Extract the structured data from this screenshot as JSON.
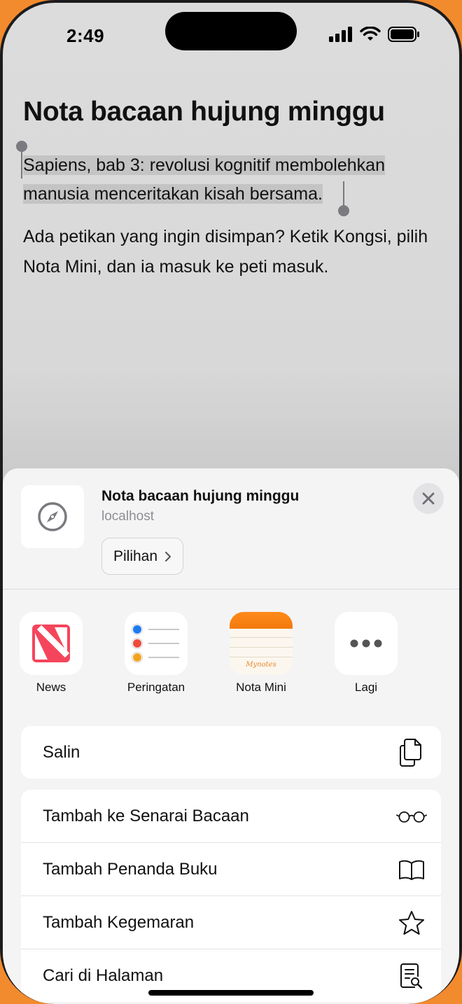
{
  "status_bar": {
    "time": "2:49"
  },
  "note": {
    "title": "Nota bacaan hujung minggu",
    "selected_line1": "Sapiens, bab 3: revolusi kognitif membolehkan",
    "selected_line2": "manusia menceritakan kisah bersama.",
    "paragraph": "Ada petikan yang ingin disimpan? Ketik Kongsi, pilih Nota Mini, dan ia masuk ke peti masuk."
  },
  "share_sheet": {
    "title": "Nota bacaan hujung minggu",
    "subtitle": "localhost",
    "options_label": "Pilihan",
    "apps": [
      {
        "label": "News",
        "icon": "news-icon"
      },
      {
        "label": "Peringatan",
        "icon": "reminders-icon"
      },
      {
        "label": "Nota Mini",
        "icon": "mynotes-icon",
        "badge_text": "Mynotes"
      },
      {
        "label": "Lagi",
        "icon": "more-icon"
      }
    ],
    "actions_group1": [
      {
        "label": "Salin",
        "icon": "copy-icon"
      }
    ],
    "actions_group2": [
      {
        "label": "Tambah ke Senarai Bacaan",
        "icon": "glasses-icon"
      },
      {
        "label": "Tambah Penanda Buku",
        "icon": "book-icon"
      },
      {
        "label": "Tambah Kegemaran",
        "icon": "star-icon"
      },
      {
        "label": "Cari di Halaman",
        "icon": "find-in-page-icon"
      }
    ]
  },
  "colors": {
    "accent_orange": "#F28A2E",
    "news_red": "#F5455C"
  }
}
